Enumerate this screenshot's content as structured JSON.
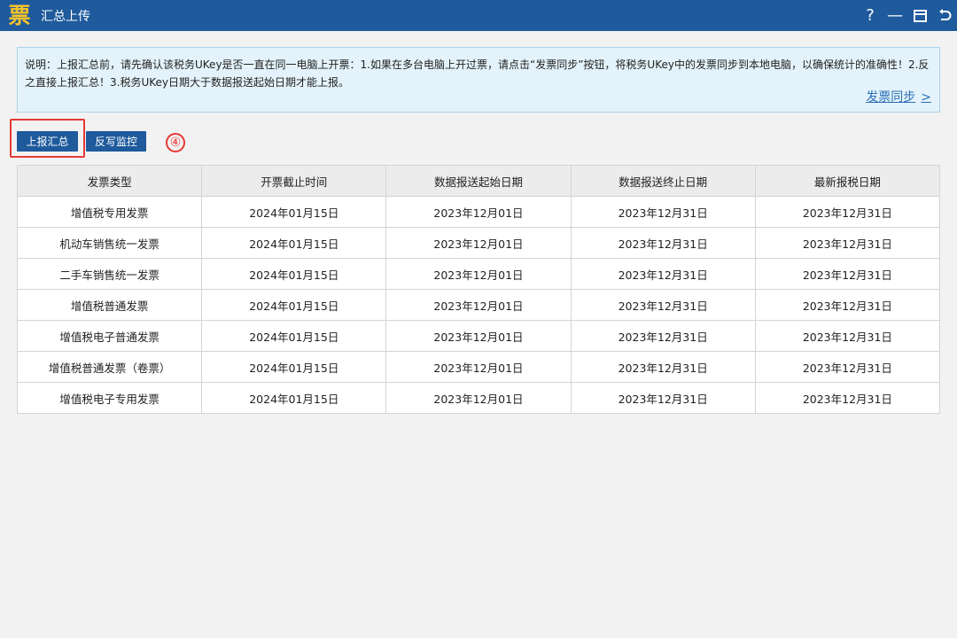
{
  "window": {
    "app_icon_glyph": "票",
    "title": "汇总上传",
    "controls": {
      "help": "?",
      "minimize": "—"
    }
  },
  "notice": {
    "text": "说明：上报汇总前，请先确认该税务UKey是否一直在同一电脑上开票：1.如果在多台电脑上开过票，请点击“发票同步”按钮，将税务UKey中的发票同步到本地电脑，以确保统计的准确性！2.反之直接上报汇总！3.税务UKey日期大于数据报送起始日期才能上报。",
    "sync_link": "发票同步",
    "sync_chevron": ">"
  },
  "toolbar": {
    "upload_summary": "上报汇总",
    "reverse_monitor": "反写监控"
  },
  "annotation": {
    "step_marker": "④",
    "color": "#e53935"
  },
  "table": {
    "headers": [
      "发票类型",
      "开票截止时间",
      "数据报送起始日期",
      "数据报送终止日期",
      "最新报税日期"
    ],
    "rows": [
      [
        "增值税专用发票",
        "2024年01月15日",
        "2023年12月01日",
        "2023年12月31日",
        "2023年12月31日"
      ],
      [
        "机动车销售统一发票",
        "2024年01月15日",
        "2023年12月01日",
        "2023年12月31日",
        "2023年12月31日"
      ],
      [
        "二手车销售统一发票",
        "2024年01月15日",
        "2023年12月01日",
        "2023年12月31日",
        "2023年12月31日"
      ],
      [
        "增值税普通发票",
        "2024年01月15日",
        "2023年12月01日",
        "2023年12月31日",
        "2023年12月31日"
      ],
      [
        "增值税电子普通发票",
        "2024年01月15日",
        "2023年12月01日",
        "2023年12月31日",
        "2023年12月31日"
      ],
      [
        "增值税普通发票（卷票）",
        "2024年01月15日",
        "2023年12月01日",
        "2023年12月31日",
        "2023年12月31日"
      ],
      [
        "增值税电子专用发票",
        "2024年01月15日",
        "2023年12月01日",
        "2023年12月31日",
        "2023年12月31日"
      ]
    ]
  },
  "colors": {
    "titlebar": "#1e5a9c",
    "button": "#1e5a9c",
    "link": "#2a6fb6",
    "notice_bg": "#e4f3fb",
    "app_icon": "#f4c22b"
  }
}
